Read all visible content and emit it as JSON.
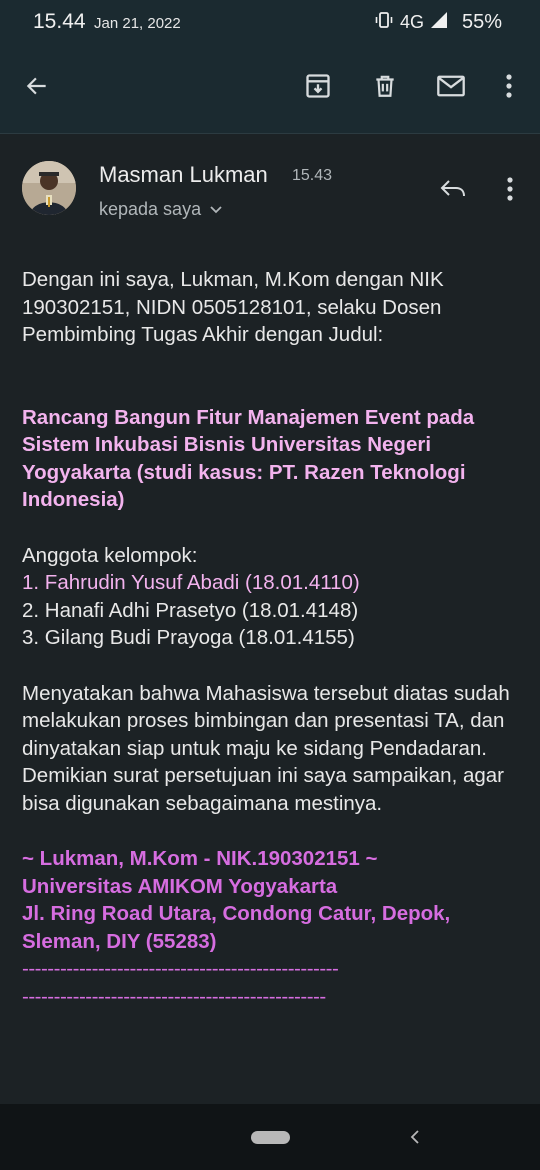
{
  "status_bar": {
    "time": "15.44",
    "date": "Jan 21, 2022",
    "network": "4G",
    "battery": "55%"
  },
  "toolbar": {
    "back_icon": "arrow-left-icon",
    "archive_icon": "archive-icon",
    "delete_icon": "trash-icon",
    "mail_icon": "mail-icon",
    "more_icon": "more-vert-icon"
  },
  "email": {
    "sender": "Masman Lukman",
    "time": "15.43",
    "recipient": "kepada saya",
    "intro": "Dengan ini saya, Lukman, M.Kom dengan NIK 190302151, NIDN 0505128101, selaku Dosen Pembimbing Tugas Akhir dengan Judul:",
    "title": "Rancang Bangun Fitur Manajemen Event pada Sistem Inkubasi Bisnis Universitas Negeri Yogyakarta (studi kasus: PT. Razen Teknologi Indonesia)",
    "members_heading": "Anggota kelompok:",
    "members": [
      "1. Fahrudin Yusuf Abadi (18.01.4110)",
      "2. Hanafi Adhi Prasetyo (18.01.4148)",
      "3. Gilang Budi Prayoga (18.01.4155)"
    ],
    "statement": "Menyatakan bahwa Mahasiswa tersebut diatas sudah melakukan proses bimbingan dan presentasi TA, dan dinyatakan siap untuk maju ke sidang Pendadaran.",
    "closing": "Demikian surat persetujuan ini saya sampaikan, agar bisa digunakan sebagaimana mestinya.",
    "signature": [
      "~ Lukman, M.Kom - NIK.190302151 ~",
      "Universitas AMIKOM Yogyakarta",
      "Jl. Ring Road Utara, Condong Catur, Depok, Sleman, DIY (55283)"
    ],
    "divider": [
      "--------------------------------------------------",
      "------------------------------------------------"
    ]
  },
  "colors": {
    "background": "#1c2225",
    "appbar": "#1b2a30",
    "title_pink": "#f3b3ee",
    "signature_purple": "#d66de0"
  }
}
